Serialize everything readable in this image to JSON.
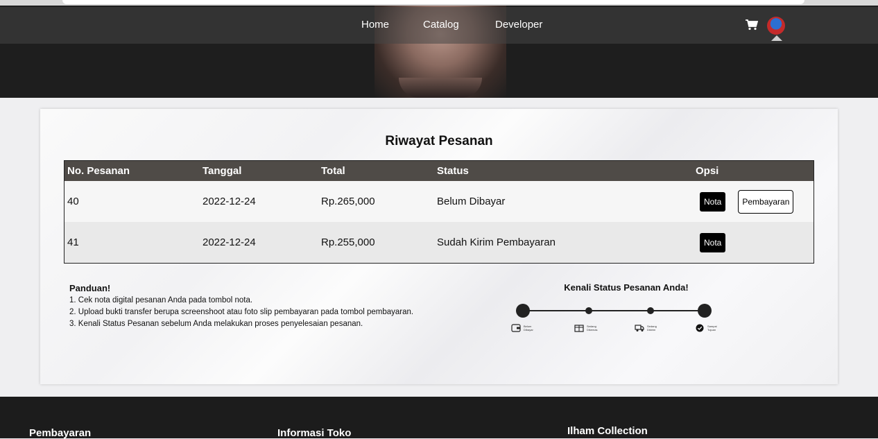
{
  "nav": {
    "links": [
      "Home",
      "Catalog",
      "Developer"
    ],
    "cart_icon": "cart-icon",
    "avatar_icon": "user-avatar"
  },
  "orders": {
    "title": "Riwayat Pesanan",
    "headers": [
      "No. Pesanan",
      "Tanggal",
      "Total",
      "Status",
      "Opsi"
    ],
    "rows": [
      {
        "no": "40",
        "tanggal": "2022-12-24",
        "total": "Rp.265,000",
        "status": "Belum Dibayar",
        "nota": "Nota",
        "bayar": "Pembayaran"
      },
      {
        "no": "41",
        "tanggal": "2022-12-24",
        "total": "Rp.255,000",
        "status": "Sudah Kirim Pembayaran",
        "nota": "Nota"
      }
    ]
  },
  "guide": {
    "title": "Panduan!",
    "items": [
      "1. Cek nota digital pesanan Anda pada tombol nota.",
      "2. Upload bukti transfer berupa screenshoot atau foto slip pembayaran pada tombol pembayaran.",
      "3. Kenali Status Pesanan sebelum Anda melakukan proses penyelesaian pesanan."
    ]
  },
  "status_guide": {
    "title": "Kenali Status Pesanan Anda!",
    "steps": [
      {
        "label": "Belum Dibayar",
        "icon": "wallet-icon"
      },
      {
        "label": "Sedang Dikemas",
        "icon": "package-icon"
      },
      {
        "label": "Sedang Dikirim",
        "icon": "truck-icon"
      },
      {
        "label": "Sampai Tujuan",
        "icon": "check-circle-icon"
      }
    ]
  },
  "footer": {
    "headings": [
      "Pembayaran",
      "Informasi Toko",
      "Ilham Collection"
    ]
  },
  "colors": {
    "table_header": "#4f4b47",
    "nav_bg": "#1e1e1e",
    "footer_bg": "#1c1c1c"
  }
}
